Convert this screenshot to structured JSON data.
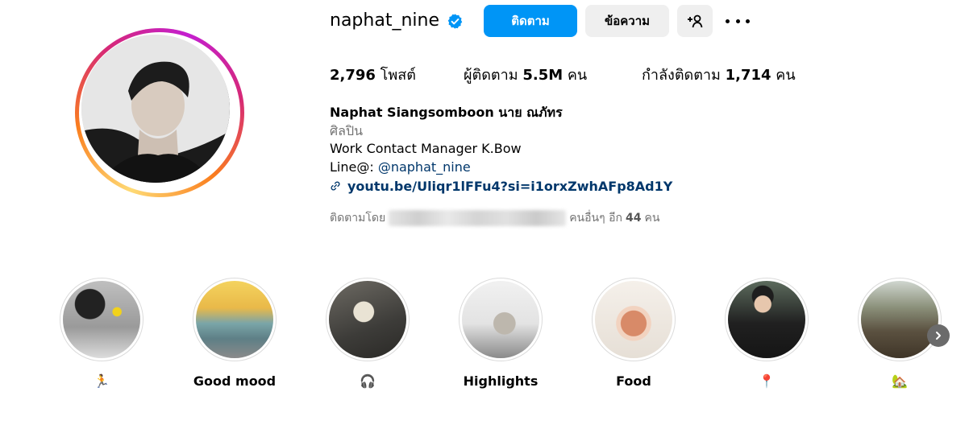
{
  "profile": {
    "username": "naphat_nine",
    "verified": true,
    "buttons": {
      "follow": "ติดตาม",
      "message": "ข้อความ",
      "add_user": "+ℛ"
    },
    "stats": {
      "posts_value": "2,796",
      "posts_label": "โพสต์",
      "followers_label": "ผู้ติดตาม",
      "followers_value": "5.5M",
      "followers_unit": "คน",
      "following_label": "กำลังติดตาม",
      "following_value": "1,714",
      "following_unit": "คน"
    },
    "bio": {
      "full_name": "Naphat Siangsomboon นาย ณภัทร",
      "category": "ศิลปิน",
      "work_contact": "Work Contact Manager K.Bow",
      "line_prefix": "Line@: ",
      "line_handle": "@naphat_nine",
      "link": "youtu.be/Uliqr1lFFu4?si=i1orxZwhAFp8Ad1Y"
    },
    "followed_by": {
      "prefix": "ติดตามโดย",
      "suffix_before": "คนอื่นๆ อีก",
      "count": "44",
      "suffix_after": "คน"
    }
  },
  "highlights": [
    {
      "label": "🏃"
    },
    {
      "label": "Good mood"
    },
    {
      "label": "🎧"
    },
    {
      "label": "Highlights"
    },
    {
      "label": "Food"
    },
    {
      "label": "📍"
    },
    {
      "label": "🏡"
    }
  ],
  "colors": {
    "accent": "#0095f6",
    "link": "#00376b",
    "secondary_text": "#737373",
    "button_gray": "#efefef"
  },
  "icons": {
    "verified": "verified-badge-icon",
    "more": "more-horizontal-icon",
    "add_user": "add-user-icon",
    "link": "link-icon",
    "next": "chevron-right-icon"
  }
}
